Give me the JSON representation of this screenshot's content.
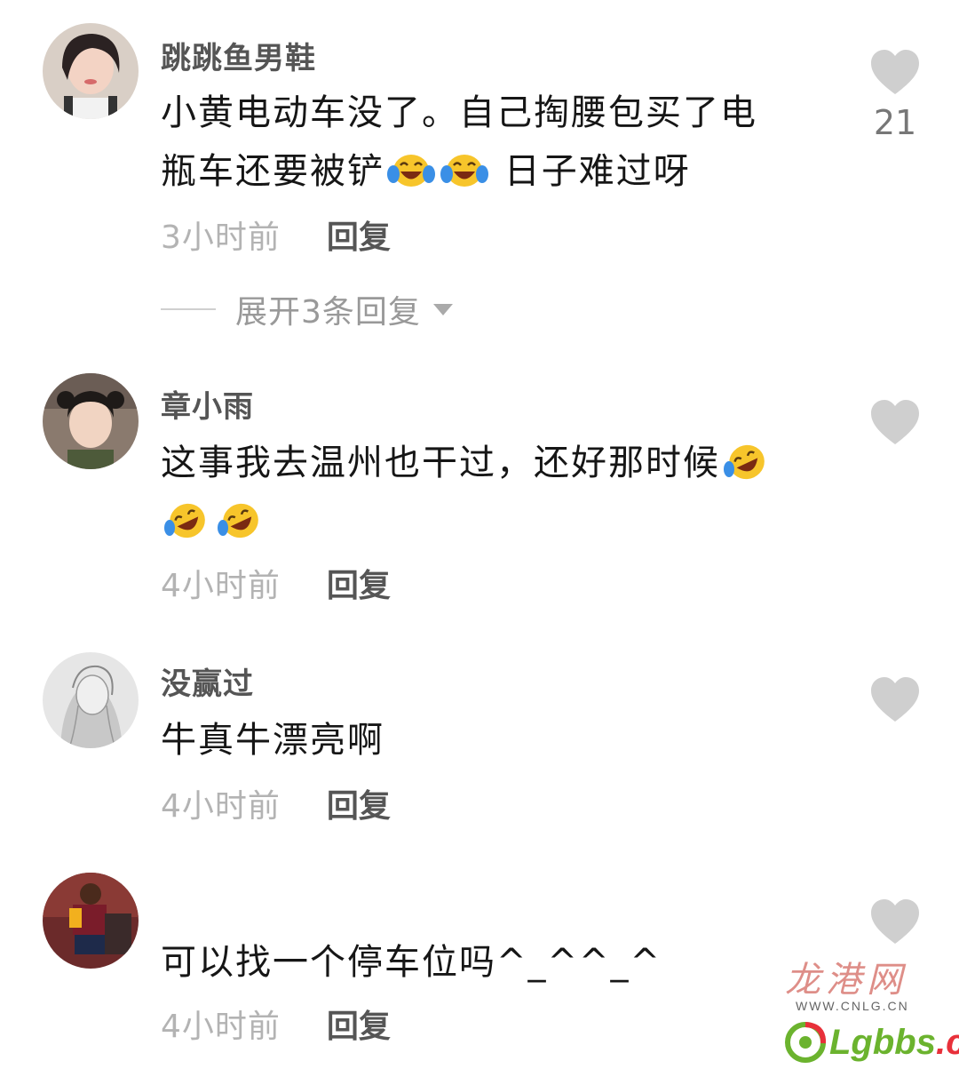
{
  "comments": [
    {
      "username": "跳跳鱼男鞋",
      "text_line1": "小黄电动车没了。自己掏腰包买了电",
      "text_line2a": "瓶车还要被铲",
      "text_line2b": " 日子难过呀",
      "time": "3小时前",
      "reply": "回复",
      "likes": "21",
      "expand": "展开3条回复"
    },
    {
      "username": "章小雨",
      "text_line1": "这事我去温州也干过，还好那时候",
      "time": "4小时前",
      "reply": "回复"
    },
    {
      "username": "没赢过",
      "text_line1": "牛真牛漂亮啊",
      "time": "4小时前",
      "reply": "回复"
    },
    {
      "username": "",
      "text_line1": "可以找一个停车位吗^_^^_^",
      "time": "4小时前",
      "reply": "回复"
    }
  ],
  "watermark": {
    "brand_cn": "龙港网",
    "domain": "WWW.CNLG.CN",
    "forum_a": "Lgbbs",
    "forum_dot": ".",
    "forum_b": "cn"
  },
  "colors": {
    "like_heart": "#cfcfcf",
    "emoji_face": "#f7c52b",
    "emoji_tear": "#3a8fe6"
  }
}
